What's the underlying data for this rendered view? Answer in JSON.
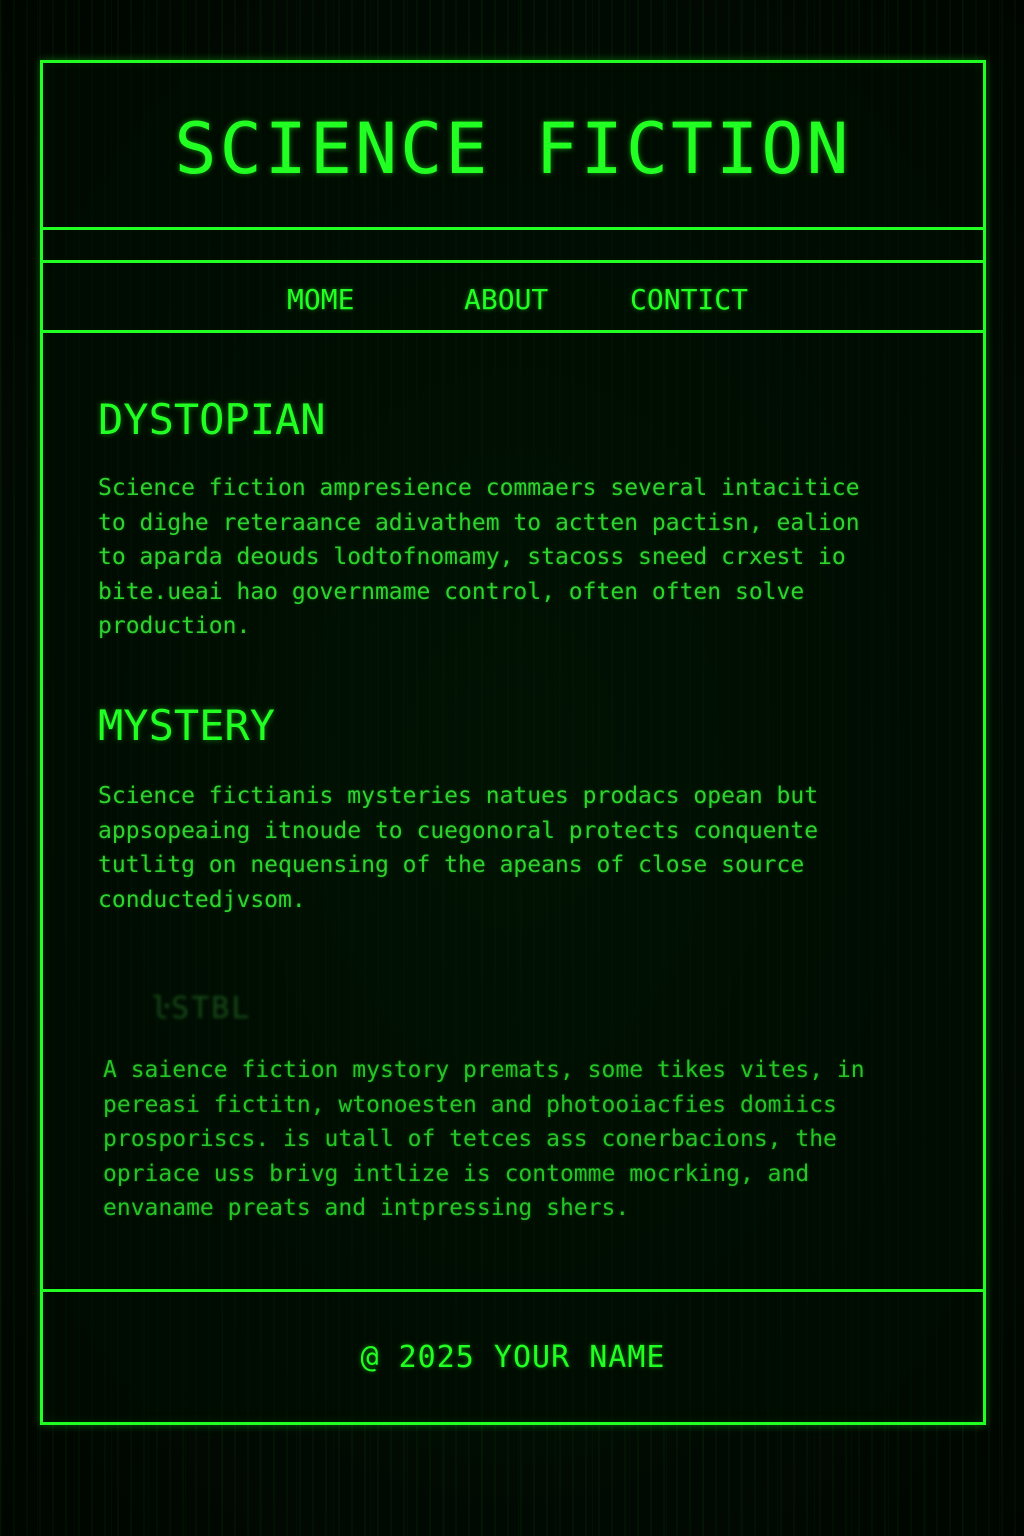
{
  "header": {
    "title": "SCIENCE FICTION"
  },
  "nav": {
    "items": [
      {
        "label": "MOME"
      },
      {
        "label": "ABOUT"
      },
      {
        "label": "CONTICT"
      }
    ]
  },
  "sections": [
    {
      "heading": "DYSTOPIAN",
      "body": "Science fiction ampresience commaers several intacitice\nto dighe reteraance adivathem to actten pactisn, ealion\nto aparda deouds lodtofnomamy, stacoss sneed crxest io\nbite.ueai hao governmame control, often often solve\nproduction."
    },
    {
      "heading": "MYSTERY",
      "body": "Science fictianis mysteries natues prodacs opean but\nappsopeaing itnoude to cuegonoral protects conquente\ntutlitg on nequensing of the apeans of close source\nconductedjvsom."
    },
    {
      "heading": "ŀSTBL",
      "body": "A saience fiction mystory premats, some tikes vites, in\npereasi fictitn, wtonoesten and photooiacfies domiics\nprosporiscs. is utall of tetces ass conerbacions, the\nopriace uss brivg intlize is contomme mocrking, and\nenvaname preats and intpressing shers."
    }
  ],
  "footer": {
    "text": "@ 2025 YOUR NAME"
  },
  "colors": {
    "accent": "#22ff22",
    "background": "#010a02"
  }
}
